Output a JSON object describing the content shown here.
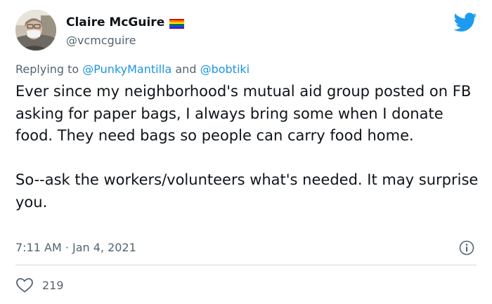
{
  "author": {
    "display_name": "Claire McGuire",
    "handle": "@vcmcguire",
    "avatar_icon": "avatar-photo",
    "badge_icon": "rainbow-flag-icon"
  },
  "reply": {
    "prefix": "Replying to",
    "mentions": [
      "@PunkyMantilla",
      "@bobtiki"
    ],
    "joiner": "and"
  },
  "tweet": {
    "paragraphs": [
      "Ever since my neighborhood's mutual aid group posted on FB asking for paper bags, I always bring some when I donate food. They need bags so people can carry food home.",
      "So--ask the workers/volunteers what's needed. It may surprise you."
    ],
    "timestamp": "7:11 AM · Jan 4, 2021"
  },
  "actions": {
    "like_icon": "heart-icon",
    "like_count": "219",
    "info_icon": "info-icon"
  },
  "colors": {
    "twitter_blue": "#1d9bf0",
    "mention_blue": "#1b95e0",
    "secondary_text": "#536471",
    "primary_text": "#0f1419",
    "divider": "#cfd9de",
    "flag": [
      "#e40303",
      "#ff8c00",
      "#ffed00",
      "#008026",
      "#004dff",
      "#750787"
    ]
  },
  "brand_icon": "twitter-bird-icon"
}
